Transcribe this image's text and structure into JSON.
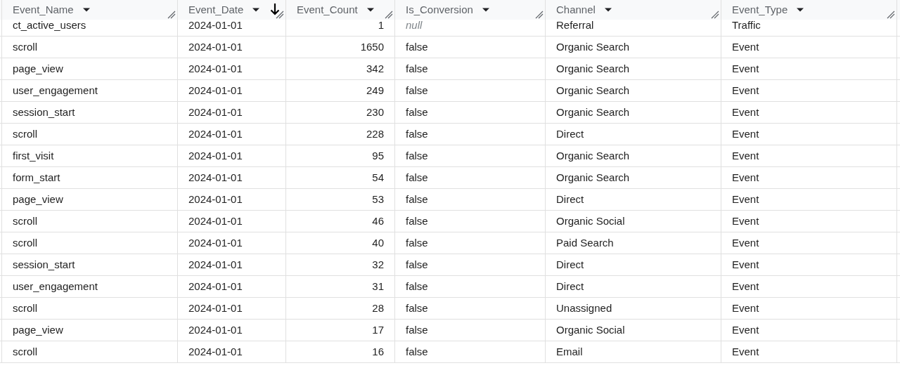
{
  "table": {
    "columns": [
      {
        "label": "Event_Name",
        "kind": "text",
        "sorted": false
      },
      {
        "label": "Event_Date",
        "kind": "text",
        "sorted": true
      },
      {
        "label": "Event_Count",
        "kind": "number",
        "sorted": false
      },
      {
        "label": "Is_Conversion",
        "kind": "text",
        "sorted": false
      },
      {
        "label": "Channel",
        "kind": "text",
        "sorted": false
      },
      {
        "label": "Event_Type",
        "kind": "text",
        "sorted": false
      }
    ],
    "rows": [
      {
        "cells": [
          "ct_active_users",
          "2024-01-01",
          "1",
          {
            "text": "null",
            "kind": "null"
          },
          "Referral",
          "Traffic"
        ]
      },
      {
        "cells": [
          "scroll",
          "2024-01-01",
          "1650",
          "false",
          "Organic Search",
          "Event"
        ]
      },
      {
        "cells": [
          "page_view",
          "2024-01-01",
          "342",
          "false",
          "Organic Search",
          "Event"
        ]
      },
      {
        "cells": [
          "user_engagement",
          "2024-01-01",
          "249",
          "false",
          "Organic Search",
          "Event"
        ]
      },
      {
        "cells": [
          "session_start",
          "2024-01-01",
          "230",
          "false",
          "Organic Search",
          "Event"
        ]
      },
      {
        "cells": [
          "scroll",
          "2024-01-01",
          "228",
          "false",
          "Direct",
          "Event"
        ]
      },
      {
        "cells": [
          "first_visit",
          "2024-01-01",
          "95",
          "false",
          "Organic Search",
          "Event"
        ]
      },
      {
        "cells": [
          "form_start",
          "2024-01-01",
          "54",
          "false",
          "Organic Search",
          "Event"
        ]
      },
      {
        "cells": [
          "page_view",
          "2024-01-01",
          "53",
          "false",
          "Direct",
          "Event"
        ]
      },
      {
        "cells": [
          "scroll",
          "2024-01-01",
          "46",
          "false",
          "Organic Social",
          "Event"
        ]
      },
      {
        "cells": [
          "scroll",
          "2024-01-01",
          "40",
          "false",
          "Paid Search",
          "Event"
        ]
      },
      {
        "cells": [
          "session_start",
          "2024-01-01",
          "32",
          "false",
          "Direct",
          "Event"
        ]
      },
      {
        "cells": [
          "user_engagement",
          "2024-01-01",
          "31",
          "false",
          "Direct",
          "Event"
        ]
      },
      {
        "cells": [
          "scroll",
          "2024-01-01",
          "28",
          "false",
          "Unassigned",
          "Event"
        ]
      },
      {
        "cells": [
          "page_view",
          "2024-01-01",
          "17",
          "false",
          "Organic Social",
          "Event"
        ]
      },
      {
        "cells": [
          "scroll",
          "2024-01-01",
          "16",
          "false",
          "Email",
          "Event"
        ]
      }
    ]
  }
}
